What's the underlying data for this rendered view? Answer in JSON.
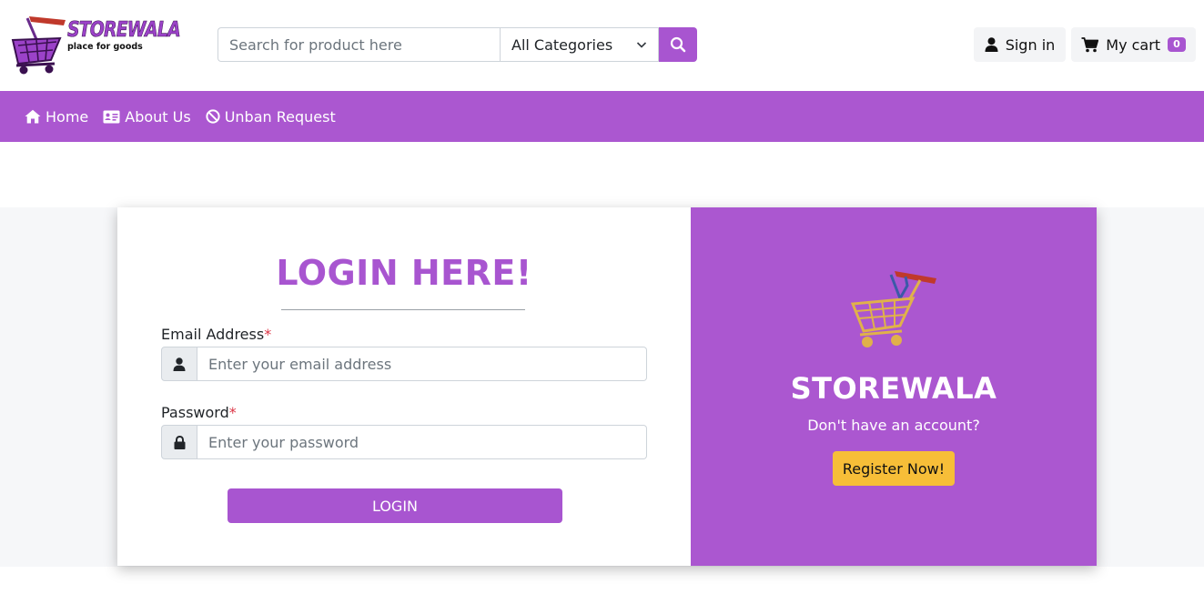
{
  "header": {
    "logo": {
      "title": "STOREWALA",
      "tagline": "place for goods"
    },
    "search": {
      "placeholder": "Search for product here",
      "value": ""
    },
    "category_select": {
      "selected": "All Categories"
    },
    "signin_label": "Sign in",
    "cart": {
      "label": "My cart",
      "count": "0"
    }
  },
  "navbar": {
    "items": [
      {
        "label": "Home",
        "icon": "home-icon"
      },
      {
        "label": "About Us",
        "icon": "id-card-icon"
      },
      {
        "label": "Unban Request",
        "icon": "ban-icon"
      }
    ]
  },
  "login": {
    "title": "LOGIN HERE!",
    "email": {
      "label": "Email Address",
      "required_mark": "*",
      "placeholder": "Enter your email address",
      "value": ""
    },
    "password": {
      "label": "Password",
      "required_mark": "*",
      "placeholder": "Enter your password",
      "value": ""
    },
    "submit_label": "LOGIN"
  },
  "side_panel": {
    "brand": "STOREWALA",
    "prompt": "Don't have an account?",
    "register_label": "Register Now!"
  },
  "colors": {
    "accent": "#ab57d0",
    "register_button": "#f7be38",
    "required": "#dc3545"
  }
}
